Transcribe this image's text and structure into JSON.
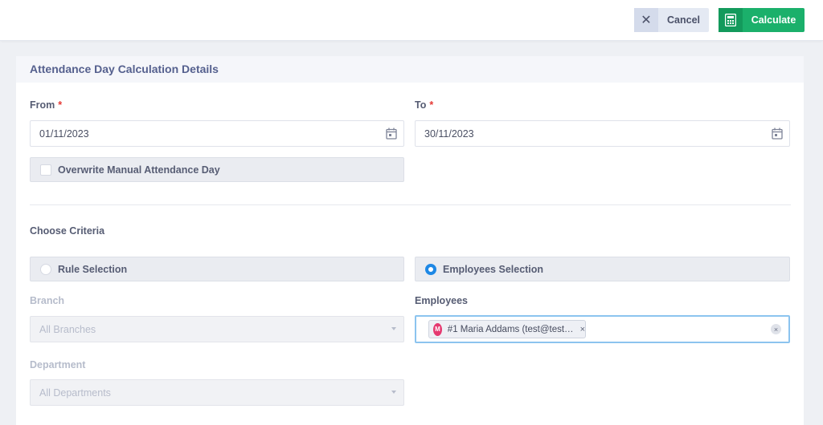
{
  "toolbar": {
    "cancel_label": "Cancel",
    "calculate_label": "Calculate"
  },
  "card": {
    "title": "Attendance Day Calculation Details"
  },
  "form": {
    "from_label": "From",
    "from_value": "01/11/2023",
    "to_label": "To",
    "to_value": "30/11/2023",
    "required_mark": "*",
    "overwrite_label": "Overwrite Manual Attendance Day",
    "overwrite_checked": false,
    "criteria_label": "Choose Criteria",
    "rule_selection_label": "Rule Selection",
    "employees_selection_label": "Employees Selection",
    "selected_criteria": "Employees Selection",
    "branch_label": "Branch",
    "branch_value": "All Branches",
    "employees_label": "Employees",
    "employee_chip": {
      "avatar_letter": "M",
      "text": "#1 Maria Addams (test@test…",
      "remove": "×"
    },
    "clear_all": "×",
    "department_label": "Department",
    "department_value": "All Departments"
  },
  "icons": {
    "cancel": "close-icon",
    "calculate": "calculator-icon",
    "date": "calendar-icon"
  },
  "colors": {
    "accent_green": "#1bb06b",
    "radio_blue": "#1e88e5",
    "required_red": "#e53935",
    "avatar_pink": "#e53970"
  }
}
